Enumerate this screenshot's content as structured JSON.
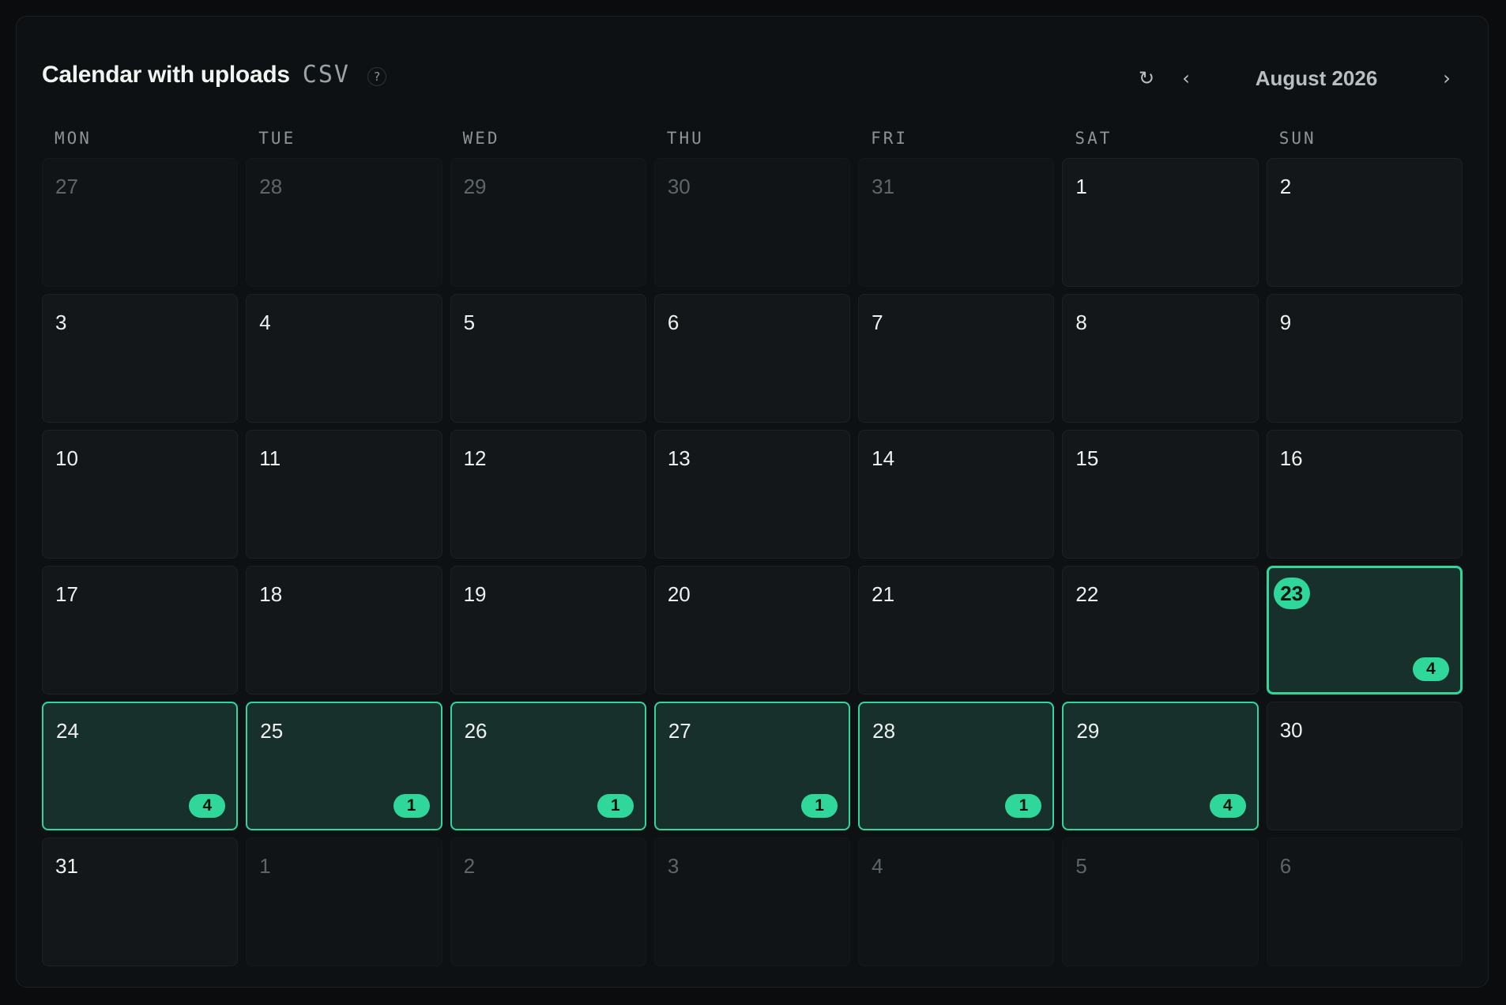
{
  "header": {
    "title": "Calendar with uploads",
    "format": "CSV",
    "help_symbol": "?",
    "refresh_symbol": "↻",
    "prev_symbol": "‹",
    "next_symbol": "›",
    "month_label": "August 2026"
  },
  "weekdays": [
    "MON",
    "TUE",
    "WED",
    "THU",
    "FRI",
    "SAT",
    "SUN"
  ],
  "colors": {
    "accent": "#2fd89a",
    "upload_cell_bg": "#17302b",
    "background": "#0e1113"
  },
  "days": [
    {
      "label": "27",
      "muted": true
    },
    {
      "label": "28",
      "muted": true
    },
    {
      "label": "29",
      "muted": true
    },
    {
      "label": "30",
      "muted": true
    },
    {
      "label": "31",
      "muted": true
    },
    {
      "label": "1"
    },
    {
      "label": "2"
    },
    {
      "label": "3"
    },
    {
      "label": "4"
    },
    {
      "label": "5"
    },
    {
      "label": "6"
    },
    {
      "label": "7"
    },
    {
      "label": "8"
    },
    {
      "label": "9"
    },
    {
      "label": "10"
    },
    {
      "label": "11"
    },
    {
      "label": "12"
    },
    {
      "label": "13"
    },
    {
      "label": "14"
    },
    {
      "label": "15"
    },
    {
      "label": "16"
    },
    {
      "label": "17"
    },
    {
      "label": "18"
    },
    {
      "label": "19"
    },
    {
      "label": "20"
    },
    {
      "label": "21"
    },
    {
      "label": "22"
    },
    {
      "label": "23",
      "today": true,
      "uploads": "4"
    },
    {
      "label": "24",
      "uploads": "4"
    },
    {
      "label": "25",
      "uploads": "1"
    },
    {
      "label": "26",
      "uploads": "1"
    },
    {
      "label": "27",
      "uploads": "1"
    },
    {
      "label": "28",
      "uploads": "1"
    },
    {
      "label": "29",
      "uploads": "4"
    },
    {
      "label": "30"
    },
    {
      "label": "31"
    },
    {
      "label": "1",
      "muted": true
    },
    {
      "label": "2",
      "muted": true
    },
    {
      "label": "3",
      "muted": true
    },
    {
      "label": "4",
      "muted": true
    },
    {
      "label": "5",
      "muted": true
    },
    {
      "label": "6",
      "muted": true
    }
  ]
}
